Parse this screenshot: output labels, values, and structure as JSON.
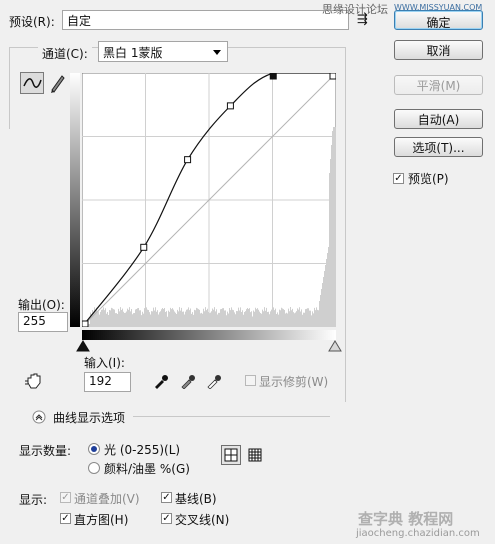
{
  "preset": {
    "label": "预设(R):",
    "value": "自定",
    "menu_glyph": "⇶"
  },
  "watermark_top": {
    "text": "思缘设计论坛",
    "url": "WWW.MISSYUAN.COM"
  },
  "buttons": {
    "ok": "确定",
    "cancel": "取消",
    "smooth": "平滑(M)",
    "auto": "自动(A)",
    "options": "选项(T)...",
    "preview": "预览(P)"
  },
  "channel": {
    "label": "通道(C):",
    "value": "黑白 1蒙版"
  },
  "output": {
    "label": "输出(O):",
    "value": "255"
  },
  "input": {
    "label": "输入(I):",
    "value": "192"
  },
  "show_clipping": "显示修剪(W)",
  "curve_options_title": "曲线显示选项",
  "show_amount": {
    "label": "显示数量:",
    "light": "光 (0-255)(L)",
    "pigment": "颜料/油墨 %(G)"
  },
  "show": {
    "label": "显示:",
    "channel_overlay": "通道叠加(V)",
    "baseline": "基线(B)",
    "histogram": "直方图(H)",
    "intersection": "交叉线(N)"
  },
  "curve": {
    "range": [
      0,
      255
    ],
    "points": [
      [
        0,
        0
      ],
      [
        62,
        80
      ],
      [
        106,
        168
      ],
      [
        149,
        222
      ],
      [
        192,
        255
      ],
      [
        255,
        255
      ]
    ]
  },
  "watermark_bottom": {
    "brand": "查字典 教程网",
    "url": "jiaocheng.chazidian.com"
  },
  "colors": {
    "accent": "#3c7fb1",
    "radio_dot": "#1f3f9a"
  }
}
